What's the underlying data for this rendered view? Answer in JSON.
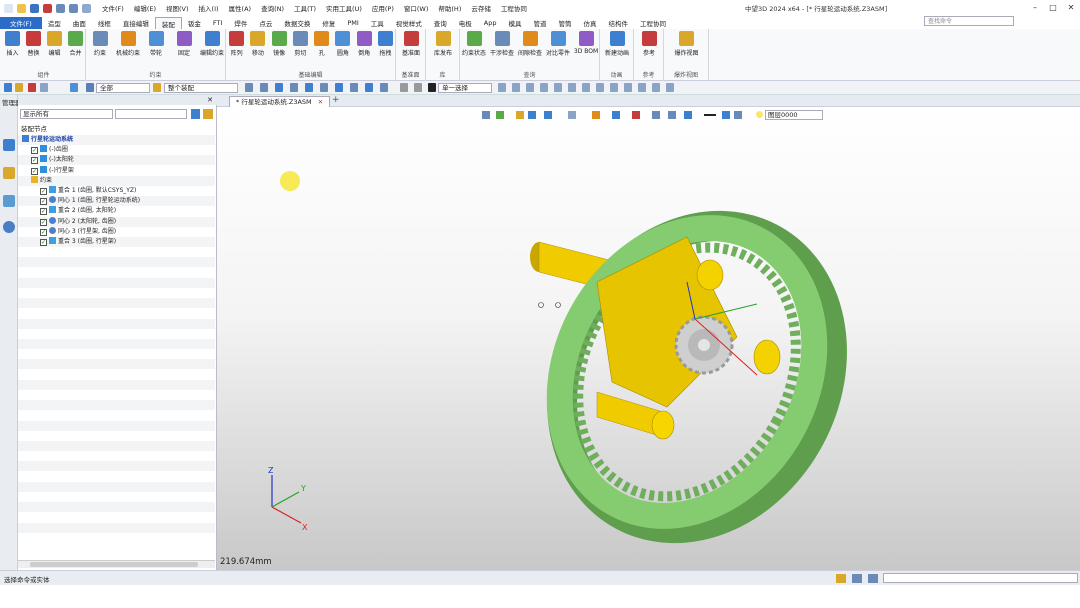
{
  "app": {
    "window_title": "中望3D 2024 x64 - [* 行星轮运动系统.Z3ASM]",
    "menus": [
      "文件(F)",
      "编辑(E)",
      "视图(V)",
      "插入(I)",
      "属性(A)",
      "查询(N)",
      "工具(T)",
      "实用工具(U)",
      "应用(P)",
      "窗口(W)",
      "帮助(H)",
      "云存储",
      "工程协同"
    ]
  },
  "ribbon": {
    "tabs": [
      "文件(F)",
      "造型",
      "曲面",
      "线框",
      "直接编辑",
      "装配",
      "钣金",
      "FTI",
      "焊件",
      "点云",
      "数据交换",
      "修复",
      "PMI",
      "工具",
      "视觉样式",
      "查询",
      "电极",
      "App",
      "模具",
      "管道",
      "管筒",
      "仿真",
      "结构件",
      "工程协同"
    ],
    "active_tab": "装配",
    "search_placeholder": "查找命令",
    "groups": [
      {
        "label": "组件",
        "buttons": [
          "插入",
          "替换",
          "编辑",
          "合并"
        ]
      },
      {
        "label": "约束",
        "buttons": [
          "约束",
          "机械约束",
          "带轮",
          "固定",
          "编辑约束"
        ]
      },
      {
        "label": "基础编辑",
        "buttons": [
          "阵列",
          "移动",
          "镜像",
          "剪切",
          "孔",
          "圆角",
          "倒角",
          "拖拽"
        ]
      },
      {
        "label": "基准面",
        "buttons": [
          "基准面"
        ]
      },
      {
        "label": "库",
        "buttons": [
          "库发布"
        ]
      },
      {
        "label": "查询",
        "buttons": [
          "约束状态",
          "干涉检查",
          "间隙检查",
          "对比零件",
          "3D BOM"
        ]
      },
      {
        "label": "动画",
        "buttons": [
          "新建动画"
        ]
      },
      {
        "label": "参考",
        "buttons": [
          "参考"
        ]
      },
      {
        "label": "爆炸视图",
        "buttons": [
          "爆炸视图"
        ]
      }
    ],
    "colors": {
      "file_tab": "#2b6cc9",
      "accent": "#2b6cc9"
    }
  },
  "toolbar2": {
    "filter_value": "全部",
    "scope_value": "整个装配",
    "select_mode": "单一选择"
  },
  "manager": {
    "title": "管理器",
    "display_filter": "显示所有",
    "section": "装配节点",
    "tree": [
      {
        "label": "行星轮运动系统",
        "level": 0,
        "kind": "root"
      },
      {
        "label": "(-)齿圈",
        "level": 1,
        "kind": "part"
      },
      {
        "label": "(-)太阳轮",
        "level": 1,
        "kind": "part"
      },
      {
        "label": "(-)行星架",
        "level": 1,
        "kind": "part"
      },
      {
        "label": "约束",
        "level": 1,
        "kind": "folder"
      },
      {
        "label": "重合 1 (齿圈, 默认CSYS_YZ)",
        "level": 2,
        "kind": "constraint"
      },
      {
        "label": "同心 1 (齿圈, 行星轮运动系统)",
        "level": 2,
        "kind": "concentric"
      },
      {
        "label": "重合 2 (齿圈, 太阳轮)",
        "level": 2,
        "kind": "constraint"
      },
      {
        "label": "同心 2 (太阳轮, 齿圈)",
        "level": 2,
        "kind": "concentric"
      },
      {
        "label": "同心 3 (行星架, 齿圈)",
        "level": 2,
        "kind": "concentric"
      },
      {
        "label": "重合 3 (齿圈, 行星架)",
        "level": 2,
        "kind": "constraint"
      }
    ]
  },
  "document": {
    "tab_label": "* 行星轮运动系统.Z3ASM",
    "view_layer": "图层0000",
    "measure": "219.674mm"
  },
  "viewport": {
    "colors": {
      "ring_gear": "#7ac567",
      "carrier": "#e8c300",
      "sun_gear": "#c9c9c9"
    }
  },
  "status": {
    "message": "选择命令或实体"
  }
}
